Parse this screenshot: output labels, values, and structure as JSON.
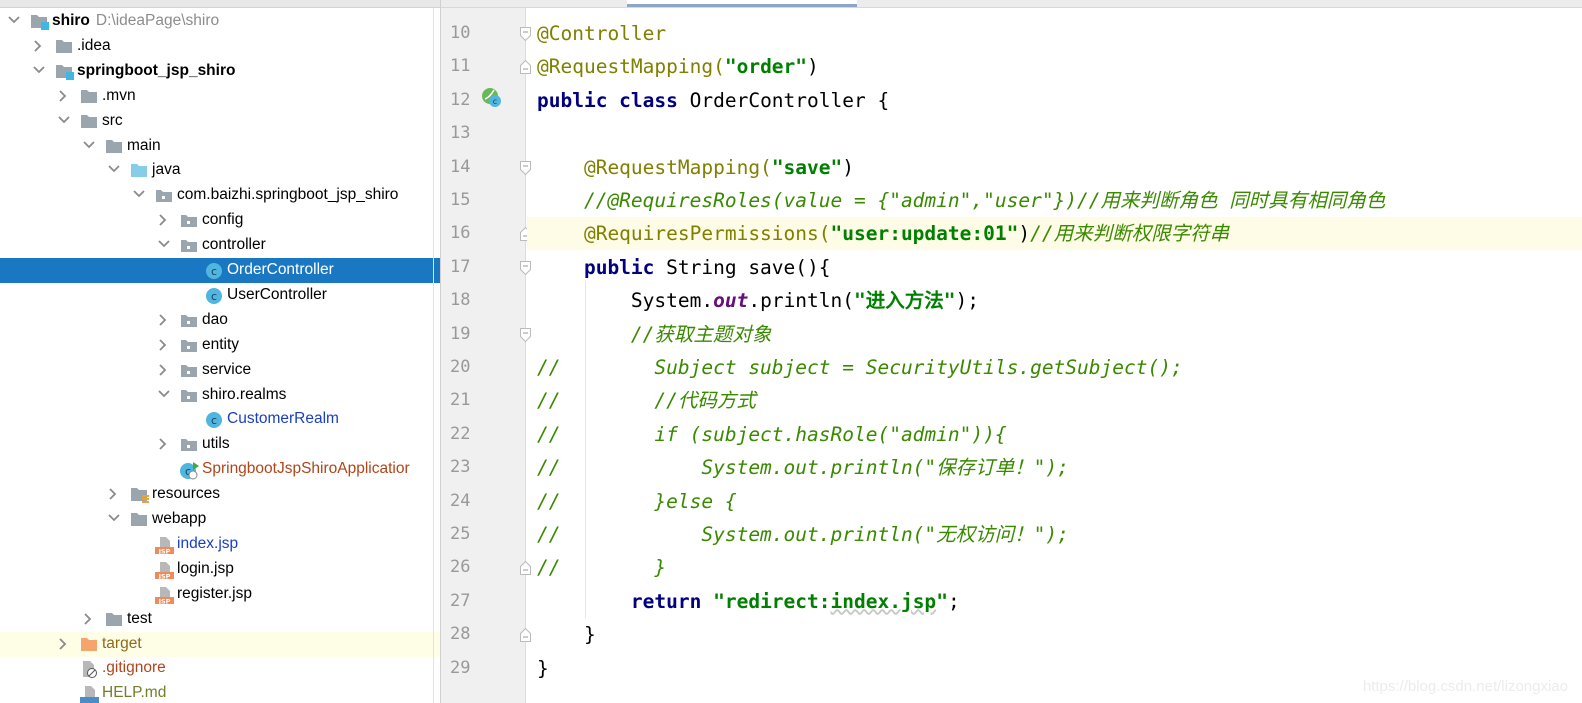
{
  "colors": {
    "selection": "#1a78c2",
    "caret_line": "#fefbe6",
    "annotation": "#808000",
    "keyword": "#000080",
    "string": "#008000",
    "comment": "#3a8a00",
    "excluded_folder": "#f4a46c"
  },
  "project_tree": {
    "items": [
      {
        "label": "shiro",
        "extra": "D:\\ideaPage\\shiro",
        "level": 0,
        "expanded": true,
        "icon": "module-folder-icon",
        "bold": true
      },
      {
        "label": ".idea",
        "level": 1,
        "expanded": false,
        "icon": "folder-icon"
      },
      {
        "label": "springboot_jsp_shiro",
        "level": 1,
        "expanded": true,
        "icon": "module-folder-icon",
        "bold": true
      },
      {
        "label": ".mvn",
        "level": 2,
        "expanded": false,
        "icon": "folder-icon"
      },
      {
        "label": "src",
        "level": 2,
        "expanded": true,
        "icon": "folder-icon"
      },
      {
        "label": "main",
        "level": 3,
        "expanded": true,
        "icon": "folder-icon"
      },
      {
        "label": "java",
        "level": 4,
        "expanded": true,
        "icon": "source-folder-icon"
      },
      {
        "label": "com.baizhi.springboot_jsp_shiro",
        "level": 5,
        "expanded": true,
        "icon": "package-icon"
      },
      {
        "label": "config",
        "level": 6,
        "expanded": false,
        "icon": "package-icon"
      },
      {
        "label": "controller",
        "level": 6,
        "expanded": true,
        "icon": "package-icon"
      },
      {
        "label": "OrderController",
        "level": 7,
        "icon": "class-icon",
        "selected": true
      },
      {
        "label": "UserController",
        "level": 7,
        "icon": "class-icon"
      },
      {
        "label": "dao",
        "level": 6,
        "expanded": false,
        "icon": "package-icon"
      },
      {
        "label": "entity",
        "level": 6,
        "expanded": false,
        "icon": "package-icon"
      },
      {
        "label": "service",
        "level": 6,
        "expanded": false,
        "icon": "package-icon"
      },
      {
        "label": "shiro.realms",
        "level": 6,
        "expanded": true,
        "icon": "package-icon"
      },
      {
        "label": "CustomerRealm",
        "level": 7,
        "icon": "class-icon",
        "color": "#1a3fbf"
      },
      {
        "label": "utils",
        "level": 6,
        "expanded": false,
        "icon": "package-icon"
      },
      {
        "label": "SpringbootJspShiroApplicatior",
        "level": 6,
        "icon": "spring-boot-class-icon",
        "color": "#b0451a"
      },
      {
        "label": "resources",
        "level": 4,
        "expanded": false,
        "icon": "resources-folder-icon"
      },
      {
        "label": "webapp",
        "level": 4,
        "expanded": true,
        "icon": "folder-icon"
      },
      {
        "label": "index.jsp",
        "level": 5,
        "icon": "jsp-file-icon",
        "color": "#1a3fbf"
      },
      {
        "label": "login.jsp",
        "level": 5,
        "icon": "jsp-file-icon"
      },
      {
        "label": "register.jsp",
        "level": 5,
        "icon": "jsp-file-icon"
      },
      {
        "label": "test",
        "level": 3,
        "expanded": false,
        "icon": "folder-icon"
      },
      {
        "label": "target",
        "level": 2,
        "expanded": false,
        "icon": "excluded-folder-icon",
        "color": "#8c6a1c",
        "highlight": true
      },
      {
        "label": ".gitignore",
        "level": 2,
        "icon": "ignored-file-icon",
        "color": "#b0451a"
      },
      {
        "label": "HELP.md",
        "level": 2,
        "icon": "markdown-file-icon",
        "color": "#6f7f2a"
      }
    ]
  },
  "editor": {
    "caret_line": 16,
    "lines": [
      {
        "n": "10",
        "fold": "start",
        "tokens": [
          {
            "t": "@Controller",
            "c": "ann"
          }
        ]
      },
      {
        "n": "11",
        "fold": "end",
        "tokens": [
          {
            "t": "@RequestMapping(",
            "c": "ann"
          },
          {
            "t": "\"order\"",
            "c": "str"
          },
          {
            "t": ")",
            "c": "plain"
          }
        ]
      },
      {
        "n": "12",
        "gutter_icon": "spring-bean-icon",
        "tokens": [
          {
            "t": "public class ",
            "c": "kw"
          },
          {
            "t": "OrderController {",
            "c": "plain"
          }
        ]
      },
      {
        "n": "13",
        "tokens": []
      },
      {
        "n": "14",
        "fold": "start",
        "tokens": [
          {
            "t": "    @RequestMapping(",
            "c": "ann"
          },
          {
            "t": "\"save\"",
            "c": "str"
          },
          {
            "t": ")",
            "c": "plain"
          }
        ]
      },
      {
        "n": "15",
        "tokens": [
          {
            "t": "    //@RequiresRoles(value = {\"admin\",\"user\"})//用来判断角色 同时具有相同角色",
            "c": "cm"
          }
        ]
      },
      {
        "n": "16",
        "fold": "end",
        "tokens": [
          {
            "t": "    @RequiresPermissions(",
            "c": "ann"
          },
          {
            "t": "\"user:update:01\"",
            "c": "str"
          },
          {
            "t": ")",
            "c": "plain"
          },
          {
            "t": "//用来判断权限字符串",
            "c": "cm"
          }
        ]
      },
      {
        "n": "17",
        "fold": "start",
        "tokens": [
          {
            "t": "    public ",
            "c": "kw"
          },
          {
            "t": "String save(){",
            "c": "plain"
          }
        ]
      },
      {
        "n": "18",
        "tokens": [
          {
            "t": "        System.",
            "c": "plain"
          },
          {
            "t": "out",
            "c": "fld"
          },
          {
            "t": ".println(",
            "c": "plain"
          },
          {
            "t": "\"进入方法\"",
            "c": "str"
          },
          {
            "t": ");",
            "c": "plain"
          }
        ]
      },
      {
        "n": "19",
        "fold": "start",
        "tokens": [
          {
            "t": "        //获取主题对象",
            "c": "cm"
          }
        ]
      },
      {
        "n": "20",
        "tokens": [
          {
            "t": "//        Subject subject = SecurityUtils.getSubject();",
            "c": "cm"
          }
        ]
      },
      {
        "n": "21",
        "tokens": [
          {
            "t": "//        //代码方式",
            "c": "cm"
          }
        ]
      },
      {
        "n": "22",
        "tokens": [
          {
            "t": "//        if (subject.hasRole(\"admin\")){",
            "c": "cm"
          }
        ]
      },
      {
        "n": "23",
        "tokens": [
          {
            "t": "//            System.out.println(\"保存订单！\");",
            "c": "cm"
          }
        ]
      },
      {
        "n": "24",
        "tokens": [
          {
            "t": "//        }else {",
            "c": "cm"
          }
        ]
      },
      {
        "n": "25",
        "tokens": [
          {
            "t": "//            System.out.println(\"无权访问！\");",
            "c": "cm"
          }
        ]
      },
      {
        "n": "26",
        "fold": "end",
        "tokens": [
          {
            "t": "//        }",
            "c": "cm"
          }
        ]
      },
      {
        "n": "27",
        "tokens": [
          {
            "t": "        return ",
            "c": "kw"
          },
          {
            "t": "\"redirect:",
            "c": "str"
          },
          {
            "t": "index.jsp",
            "c": "str wavy"
          },
          {
            "t": "\"",
            "c": "str"
          },
          {
            "t": ";",
            "c": "plain"
          }
        ]
      },
      {
        "n": "28",
        "fold": "end",
        "tokens": [
          {
            "t": "    }",
            "c": "plain"
          }
        ]
      },
      {
        "n": "29",
        "tokens": [
          {
            "t": "}",
            "c": "plain"
          }
        ]
      }
    ]
  },
  "watermark": "https://blog.csdn.net/lizongxiao"
}
